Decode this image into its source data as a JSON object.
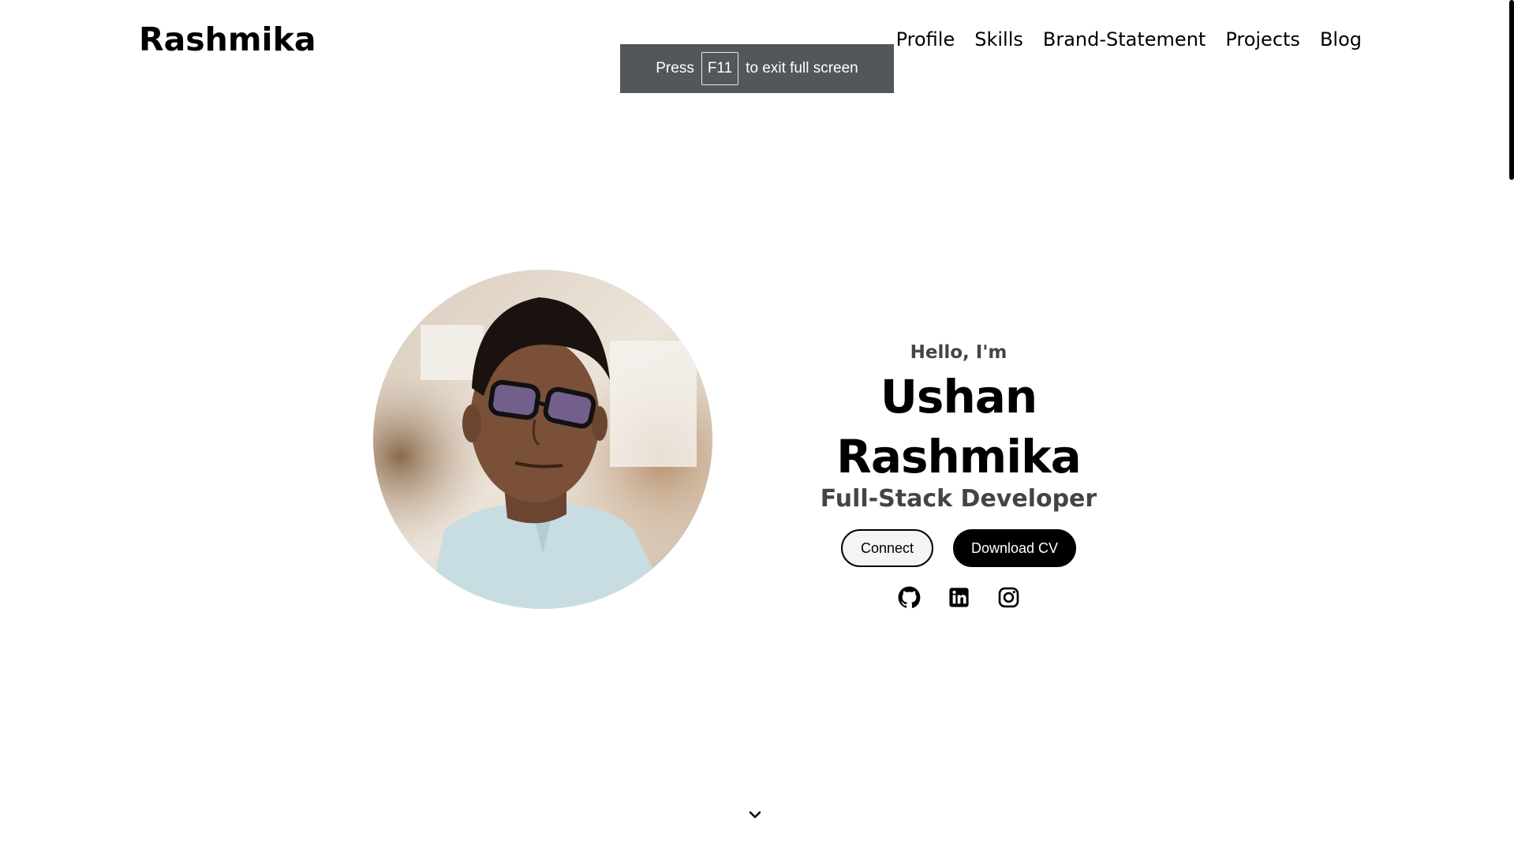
{
  "header": {
    "logo": "Rashmika",
    "nav": [
      {
        "label": "Profile"
      },
      {
        "label": "Skills"
      },
      {
        "label": "Brand-Statement"
      },
      {
        "label": "Projects"
      },
      {
        "label": "Blog"
      }
    ]
  },
  "fullscreen_toast": {
    "prefix": "Press",
    "key": "F11",
    "suffix": "to exit full screen"
  },
  "hero": {
    "greeting": "Hello, I'm",
    "name": "Ushan Rashmika",
    "role": "Full-Stack Developer",
    "connect_label": "Connect",
    "download_label": "Download CV",
    "socials": [
      {
        "icon": "github-icon"
      },
      {
        "icon": "linkedin-icon"
      },
      {
        "icon": "instagram-icon"
      }
    ]
  },
  "colors": {
    "text_primary": "#000000",
    "text_secondary": "#444444",
    "toast_bg": "#53565a",
    "button_solid_bg": "#000000",
    "button_outline_bg": "#f4f4f4"
  }
}
